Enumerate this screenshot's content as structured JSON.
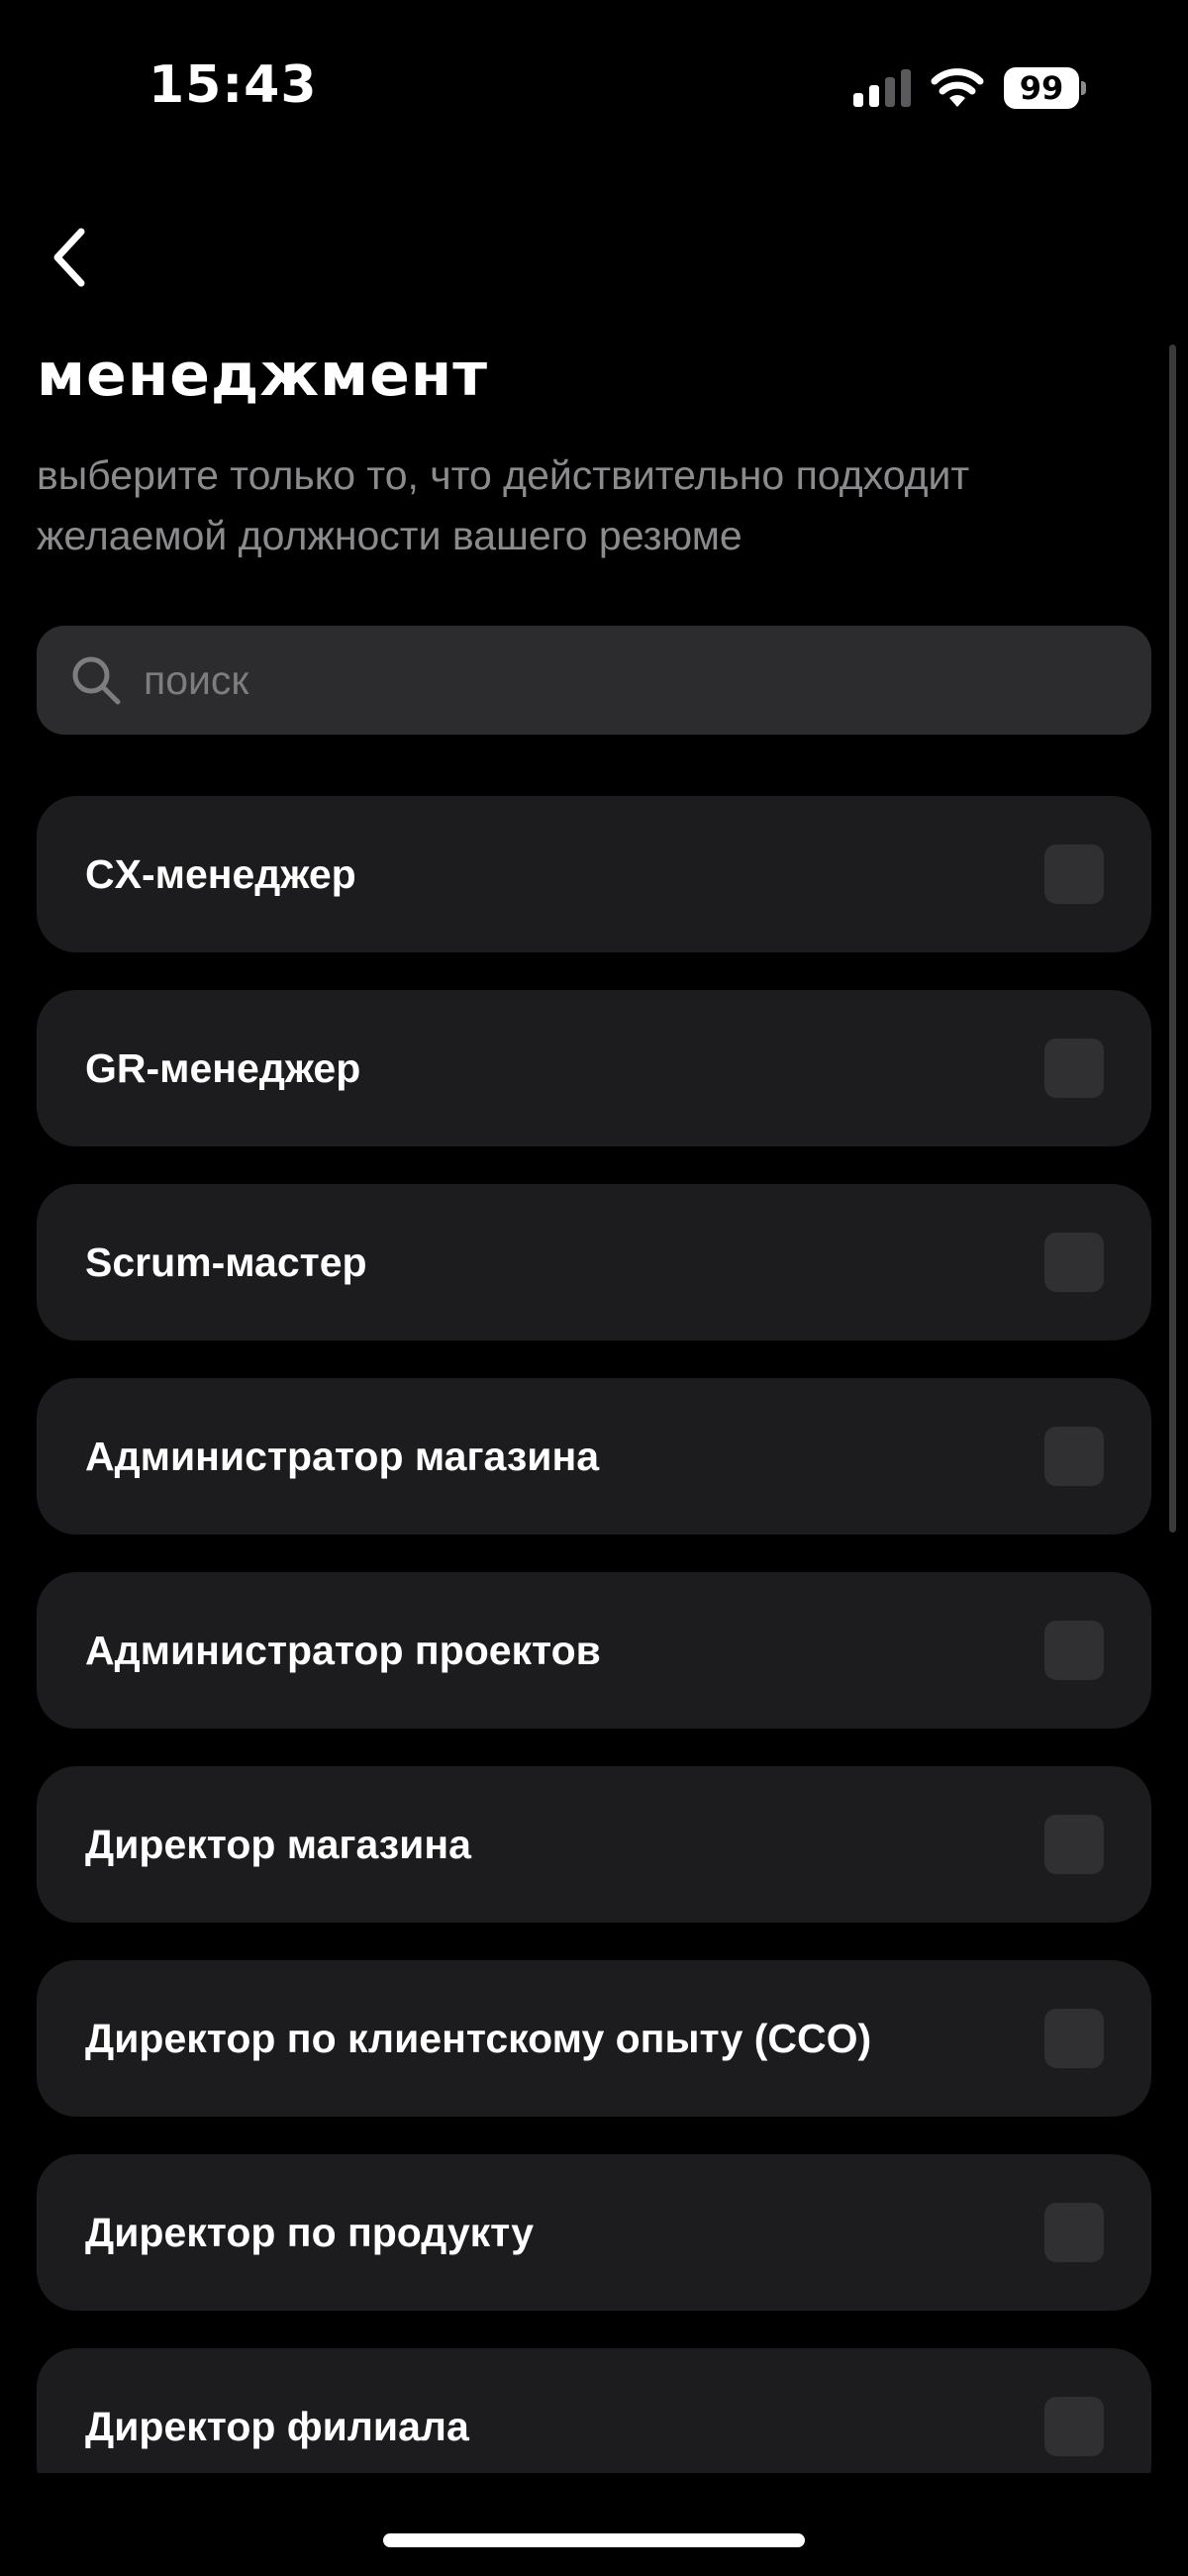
{
  "status_bar": {
    "time": "15:43",
    "battery_level": "99",
    "icons": [
      "signal-icon",
      "wifi-icon",
      "battery-icon"
    ]
  },
  "header": {
    "back_icon": "chevron-left-icon",
    "title": "менеджмент",
    "subtitle": "выберите только то, что действительно подходит желаемой должности вашего резюме"
  },
  "search": {
    "placeholder": "поиск",
    "value": "",
    "icon": "search-icon"
  },
  "items": [
    {
      "label": "CX-менеджер",
      "checked": false
    },
    {
      "label": "GR-менеджер",
      "checked": false
    },
    {
      "label": "Scrum-мастер",
      "checked": false
    },
    {
      "label": "Администратор магазина",
      "checked": false
    },
    {
      "label": "Администратор проектов",
      "checked": false
    },
    {
      "label": "Директор магазина",
      "checked": false
    },
    {
      "label": "Директор по клиентскому опыту (CCO)",
      "checked": false
    },
    {
      "label": "Директор по продукту",
      "checked": false
    },
    {
      "label": "Директор филиала",
      "checked": false
    }
  ],
  "colors": {
    "background": "#000000",
    "card": "#1c1c1e",
    "search_bg": "#2c2c2e",
    "checkbox": "#303033",
    "secondary_text": "#8b8b8e"
  }
}
